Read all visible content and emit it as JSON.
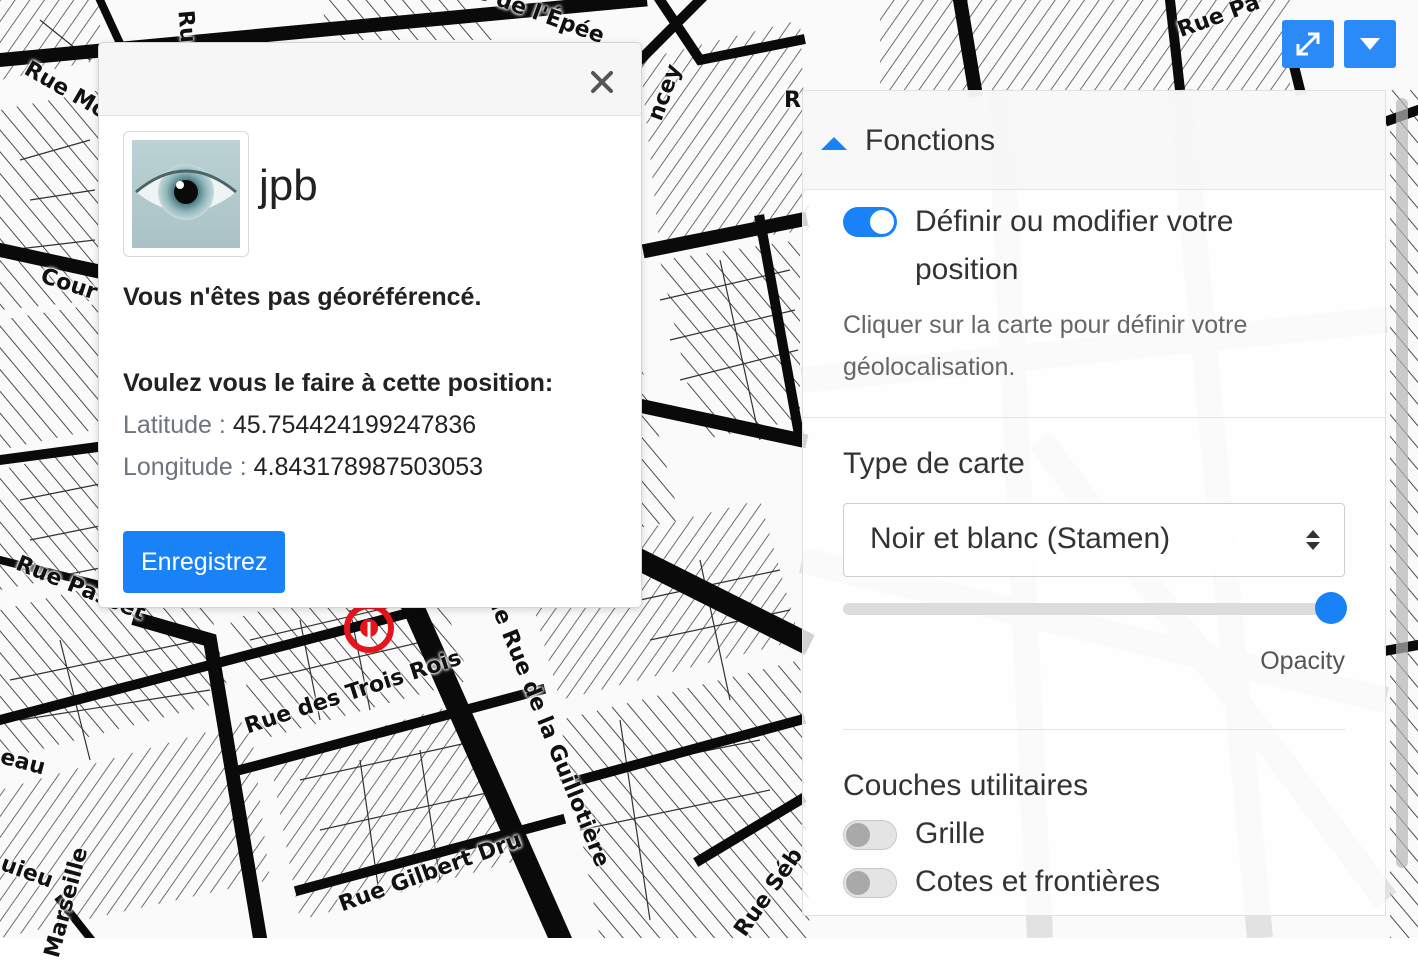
{
  "map": {
    "street_labels": [
      "Rue Mo",
      "Rue de l'Épée",
      "Cour",
      "ncey",
      "Rue Passet",
      "Rue des Trois Rois",
      "de Rue de la Guillotière",
      "eau",
      "uieu",
      "Marseille",
      "Rue Gilbert Dru",
      "Rue Séb",
      "Rue Pa",
      "Ru",
      "R"
    ],
    "marker_color": "#e8141b",
    "expand_icon": "expand-icon",
    "menu_icon": "caret-down-icon"
  },
  "popup": {
    "close_glyph": "×",
    "username": "jpb",
    "not_geo_text": "Vous n'êtes pas géoréférencé.",
    "question": "Voulez vous le faire à cette position:",
    "latitude_label": "Latitude :",
    "latitude_value": "45.754424199247836",
    "longitude_label": "Longitude :",
    "longitude_value": "4.843178987503053",
    "save_label": "Enregistrez",
    "accent": "#1a82f7"
  },
  "panel": {
    "title": "Fonctions",
    "position_toggle_label_line1": "Définir ou modifier votre",
    "position_toggle_label_line2": "position",
    "position_toggle_on": true,
    "position_help_line1": "Cliquer sur la carte pour définir votre",
    "position_help_line2": "géolocalisation.",
    "map_type_heading": "Type de carte",
    "map_type_selected": "Noir et blanc (Stamen)",
    "opacity_label": "Opacity",
    "opacity_value": 1.0,
    "utility_layers_heading": "Couches utilitaires",
    "grid_label": "Grille",
    "grid_on": false,
    "borders_label": "Cotes et frontières",
    "borders_on": false
  }
}
